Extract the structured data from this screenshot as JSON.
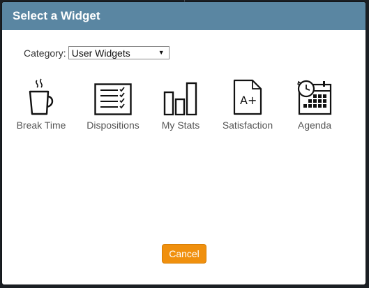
{
  "dialog": {
    "title": "Select a Widget"
  },
  "category": {
    "label": "Category:",
    "selected": "User Widgets"
  },
  "widgets": [
    {
      "label": "Break Time",
      "icon": "coffee-cup-icon"
    },
    {
      "label": "Dispositions",
      "icon": "checklist-icon"
    },
    {
      "label": "My Stats",
      "icon": "bar-chart-icon"
    },
    {
      "label": "Satisfaction",
      "icon": "grade-document-icon"
    },
    {
      "label": "Agenda",
      "icon": "calendar-clock-icon"
    }
  ],
  "buttons": {
    "cancel": "Cancel"
  },
  "colors": {
    "header": "#5a86a2",
    "cancel": "#f0900e",
    "backdrop": "#1b1f24"
  }
}
